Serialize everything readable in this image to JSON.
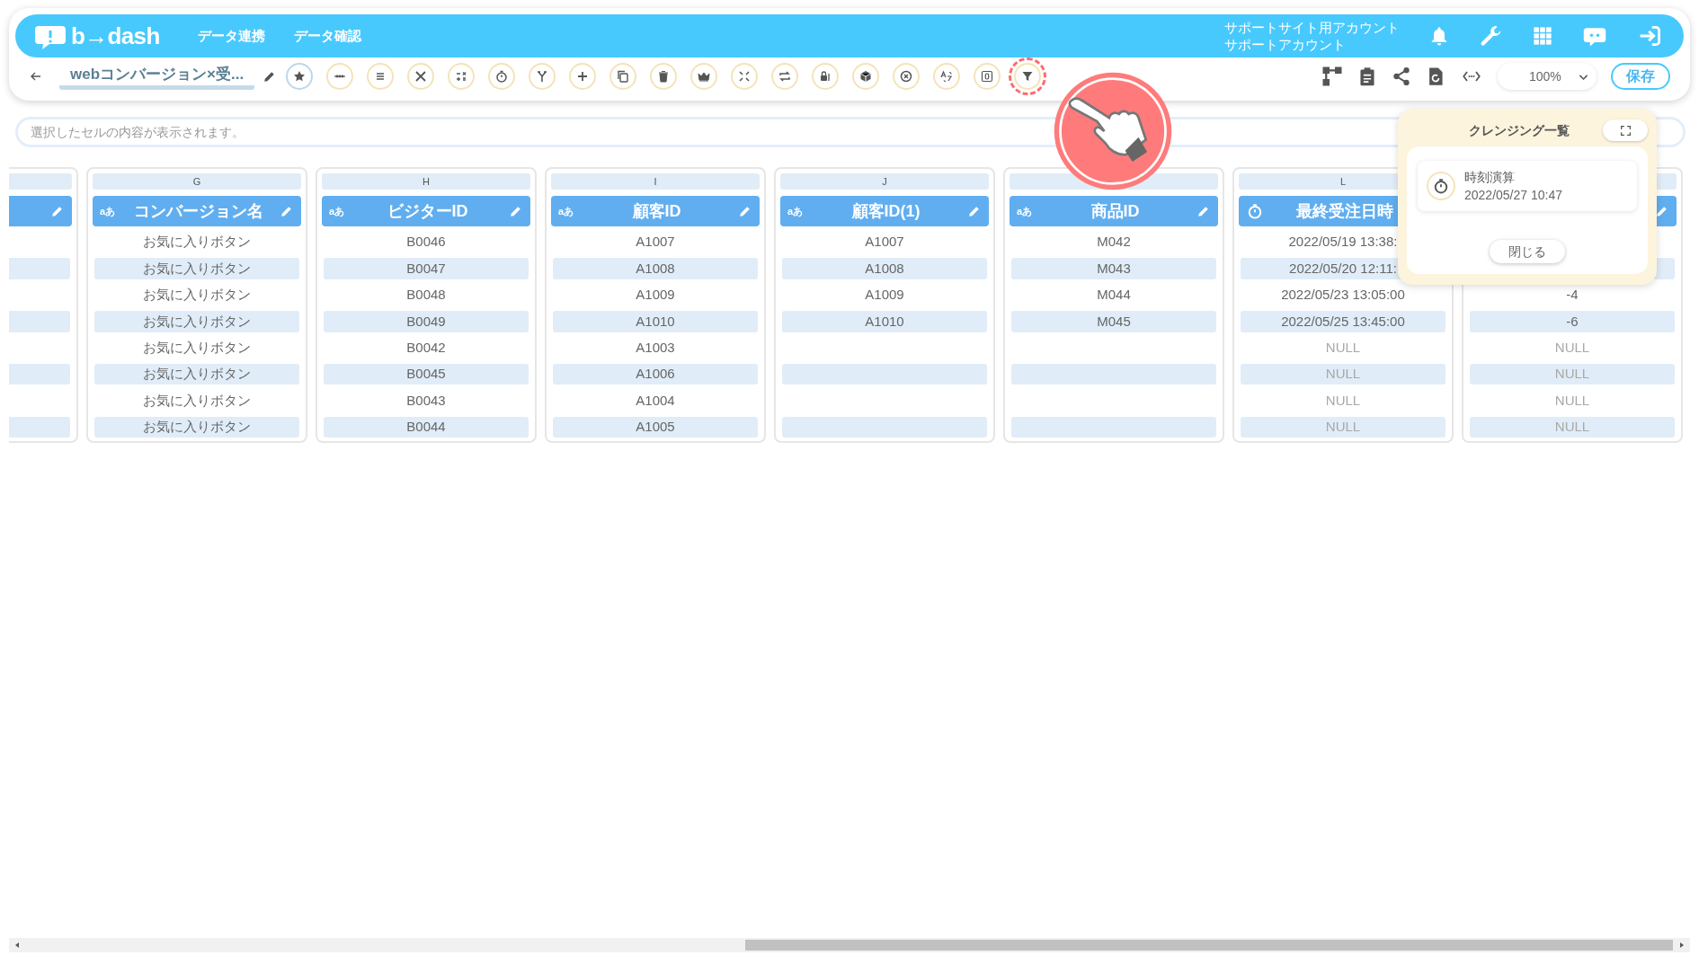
{
  "header": {
    "logo": "b→dash",
    "nav": [
      {
        "label": "データ連携"
      },
      {
        "label": "データ確認"
      }
    ],
    "account": [
      "サポートサイト用アカウント",
      "サポートアカウント"
    ]
  },
  "toolbar": {
    "title": "webコンバージョン×受...",
    "tools": [
      {
        "kind": "star",
        "highlighted": false
      },
      {
        "kind": "dots",
        "highlighted": false
      },
      {
        "kind": "lines",
        "highlighted": false
      },
      {
        "kind": "tools",
        "highlighted": false
      },
      {
        "kind": "calc",
        "highlighted": false
      },
      {
        "kind": "timer",
        "highlighted": false
      },
      {
        "kind": "split",
        "highlighted": false
      },
      {
        "kind": "plus",
        "highlighted": false
      },
      {
        "kind": "copy",
        "highlighted": false
      },
      {
        "kind": "trash",
        "highlighted": false
      },
      {
        "kind": "crown",
        "highlighted": false
      },
      {
        "kind": "compress",
        "highlighted": false
      },
      {
        "kind": "repeat",
        "highlighted": false
      },
      {
        "kind": "lock",
        "highlighted": false
      },
      {
        "kind": "box",
        "highlighted": false
      },
      {
        "kind": "cancel",
        "highlighted": false
      },
      {
        "kind": "translate",
        "highlighted": false
      },
      {
        "kind": "zero",
        "highlighted": false
      },
      {
        "kind": "filter",
        "highlighted": true
      }
    ],
    "zoom": "100%",
    "save": "保存"
  },
  "cell_viewer": {
    "placeholder": "選択したセルの内容が表示されます。"
  },
  "columns": [
    {
      "cells": [
        null,
        null,
        null,
        null,
        null,
        null,
        null,
        null
      ]
    },
    {
      "letter": "G",
      "kind": "text",
      "type_label": "aあ",
      "label": "コンバージョン名",
      "cells": [
        "お気に入りボタン",
        "お気に入りボタン",
        "お気に入りボタン",
        "お気に入りボタン",
        "お気に入りボタン",
        "お気に入りボタン",
        "お気に入りボタン",
        "お気に入りボタン"
      ]
    },
    {
      "letter": "H",
      "kind": "text",
      "type_label": "aあ",
      "label": "ビジターID",
      "cells": [
        "B0046",
        "B0047",
        "B0048",
        "B0049",
        "B0042",
        "B0045",
        "B0043",
        "B0044"
      ]
    },
    {
      "letter": "I",
      "kind": "text",
      "type_label": "aあ",
      "label": "顧客ID",
      "cells": [
        "A1007",
        "A1008",
        "A1009",
        "A1010",
        "A1003",
        "A1006",
        "A1004",
        "A1005"
      ]
    },
    {
      "letter": "J",
      "kind": "text",
      "type_label": "aあ",
      "label": "顧客ID(1)",
      "cells": [
        "A1007",
        "A1008",
        "A1009",
        "A1010",
        null,
        null,
        null,
        null
      ]
    },
    {
      "kind": "text",
      "type_label": "aあ",
      "label": "商品ID",
      "cells": [
        "M042",
        "M043",
        "M044",
        "M045",
        null,
        null,
        null,
        null
      ]
    },
    {
      "letter": "L",
      "kind": "datetime",
      "label": "最終受注日時",
      "cells": [
        "2022/05/19 13:38:",
        "2022/05/20 12:11:",
        "2022/05/23 13:05:00",
        "2022/05/25 13:45:00",
        {
          "text": "NULL",
          "muted": true
        },
        {
          "text": "NULL",
          "muted": true
        },
        {
          "text": "NULL",
          "muted": true
        },
        {
          "text": "NULL",
          "muted": true
        }
      ]
    },
    {
      "cells": [
        null,
        null,
        "-4",
        "-6",
        {
          "text": "NULL",
          "muted": true
        },
        {
          "text": "NULL",
          "muted": true
        },
        {
          "text": "NULL",
          "muted": true
        },
        {
          "text": "NULL",
          "muted": true
        }
      ]
    }
  ],
  "popup": {
    "title": "クレンジング一覧",
    "items": [
      {
        "kind": "timer",
        "name": "時刻演算",
        "time": "2022/05/27 10:47"
      }
    ],
    "close": "閉じる"
  }
}
